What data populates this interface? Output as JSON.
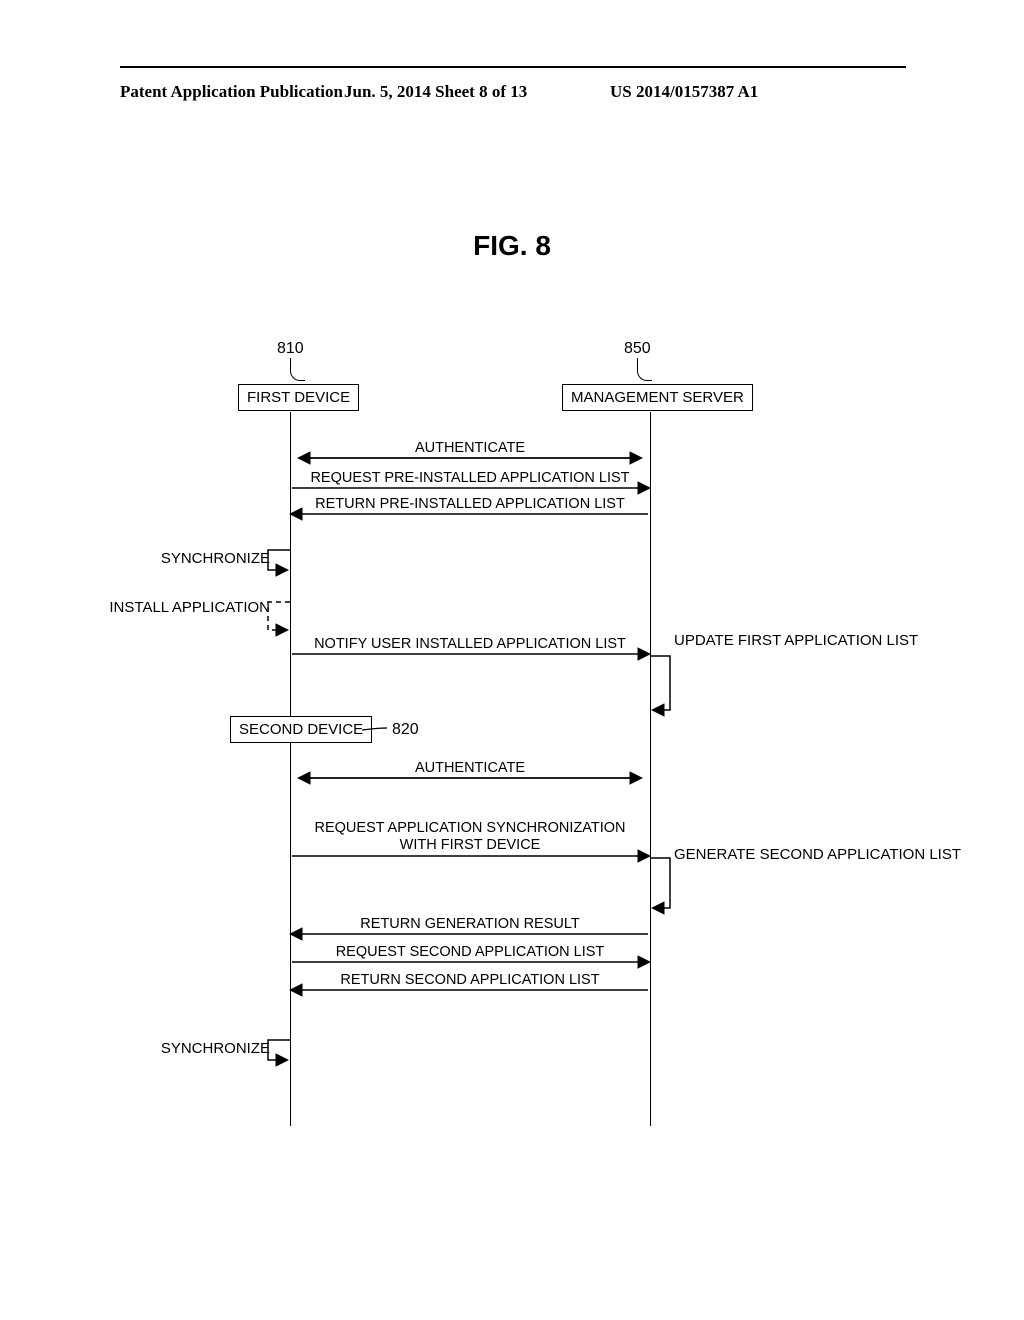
{
  "header": {
    "left": "Patent Application Publication",
    "mid": "Jun. 5, 2014   Sheet 8 of 13",
    "right": "US 2014/0157387 A1"
  },
  "figure_title": "FIG. 8",
  "refs": {
    "first_device": "810",
    "second_device": "820",
    "management_server": "850"
  },
  "actors": {
    "first_device": "FIRST DEVICE",
    "second_device": "SECOND DEVICE",
    "management_server": "MANAGEMENT SERVER"
  },
  "messages": {
    "m1": "AUTHENTICATE",
    "m2": "REQUEST PRE-INSTALLED APPLICATION LIST",
    "m3": "RETURN PRE-INSTALLED APPLICATION LIST",
    "m4": "NOTIFY USER INSTALLED APPLICATION LIST",
    "m5": "AUTHENTICATE",
    "m6": "REQUEST APPLICATION SYNCHRONIZATION\nWITH FIRST DEVICE",
    "m7": "RETURN GENERATION RESULT",
    "m8": "REQUEST SECOND APPLICATION LIST",
    "m9": "RETURN SECOND APPLICATION LIST"
  },
  "self_left": {
    "s1": "SYNCHRONIZE",
    "s2": "INSTALL\nAPPLICATION",
    "s3": "SYNCHRONIZE"
  },
  "self_right": {
    "r1": "UPDATE\nFIRST\nAPPLICATION\nLIST",
    "r2": "GENERATE\nSECOND\nAPPLICATION\nLIST"
  }
}
